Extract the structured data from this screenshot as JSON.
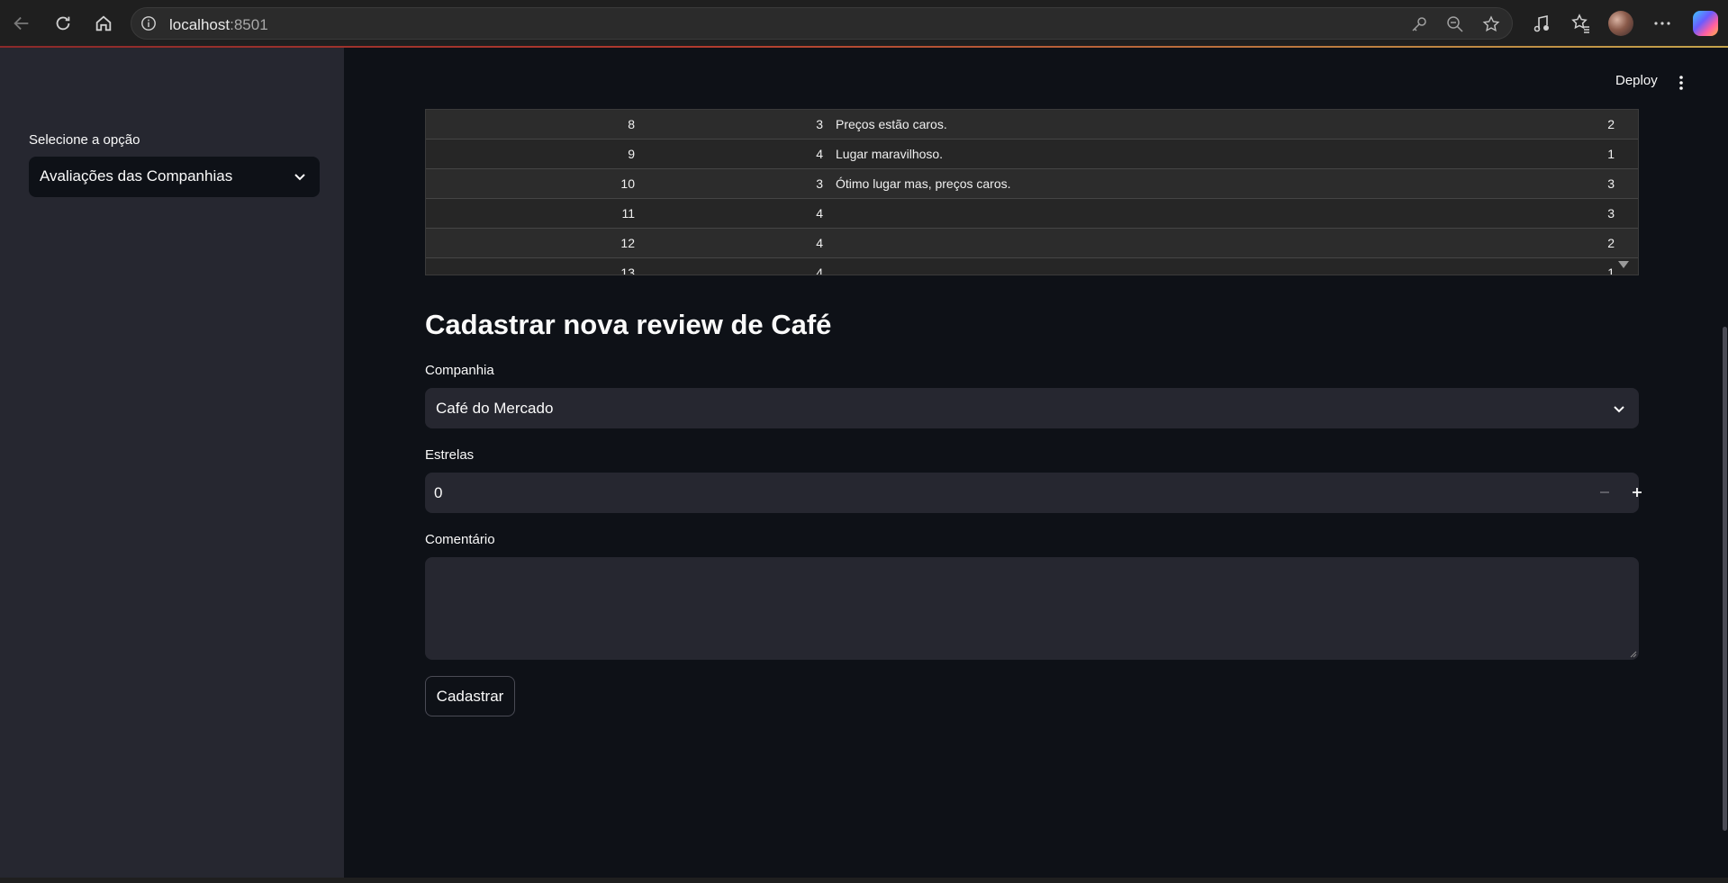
{
  "browser": {
    "url_host": "localhost",
    "url_port": ":8501"
  },
  "sidebar": {
    "select_label": "Selecione a opção",
    "select_value": "Avaliações das Companhias"
  },
  "header": {
    "deploy_label": "Deploy"
  },
  "table": {
    "rows": [
      {
        "id": "8",
        "stars": "3",
        "comment": "Preços estão caros.",
        "company": "2"
      },
      {
        "id": "9",
        "stars": "4",
        "comment": "Lugar maravilhoso.",
        "company": "1"
      },
      {
        "id": "10",
        "stars": "3",
        "comment": "Ótimo lugar mas, preços caros.",
        "company": "3"
      },
      {
        "id": "11",
        "stars": "4",
        "comment": "",
        "company": "3"
      },
      {
        "id": "12",
        "stars": "4",
        "comment": "",
        "company": "2"
      },
      {
        "id": "13",
        "stars": "4",
        "comment": "",
        "company": "1"
      }
    ]
  },
  "form": {
    "title": "Cadastrar nova review de Café",
    "company_label": "Companhia",
    "company_value": "Café do Mercado",
    "stars_label": "Estrelas",
    "stars_value": "0",
    "comment_label": "Comentário",
    "comment_value": "",
    "submit_label": "Cadastrar"
  }
}
